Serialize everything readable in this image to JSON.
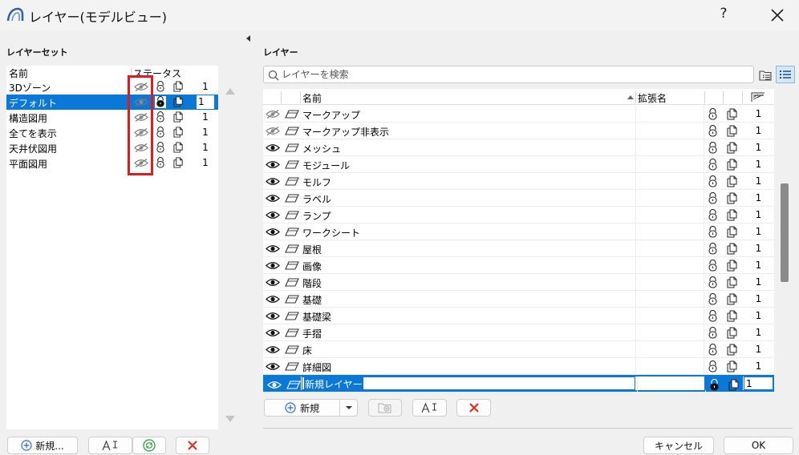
{
  "window": {
    "title": "レイヤー(モデルビュー)",
    "help_label": "?"
  },
  "left_panel": {
    "title": "レイヤーセット",
    "columns": {
      "name": "名前",
      "status": "ステータス"
    },
    "rows": [
      {
        "name": "3Dゾーン",
        "pen": "1",
        "selected": false
      },
      {
        "name": "デフォルト",
        "pen": "1",
        "selected": true
      },
      {
        "name": "構造図用",
        "pen": "1",
        "selected": false
      },
      {
        "name": "全てを表示",
        "pen": "1",
        "selected": false
      },
      {
        "name": "天井伏図用",
        "pen": "1",
        "selected": false
      },
      {
        "name": "平面図用",
        "pen": "1",
        "selected": false
      }
    ],
    "buttons": {
      "new_label": "新規..."
    }
  },
  "right_panel": {
    "title": "レイヤー",
    "search": {
      "placeholder": "レイヤーを検索",
      "value": ""
    },
    "columns": {
      "name": "名前",
      "extension": "拡張名"
    },
    "rows": [
      {
        "eye": "hidden",
        "name": "マークアップ",
        "pen": "1"
      },
      {
        "eye": "hidden",
        "name": "マークアップ非表示",
        "pen": "1"
      },
      {
        "eye": "visible",
        "name": "メッシュ",
        "pen": "1"
      },
      {
        "eye": "visible",
        "name": "モジュール",
        "pen": "1"
      },
      {
        "eye": "visible",
        "name": "モルフ",
        "pen": "1"
      },
      {
        "eye": "visible",
        "name": "ラベル",
        "pen": "1"
      },
      {
        "eye": "visible",
        "name": "ランプ",
        "pen": "1"
      },
      {
        "eye": "visible",
        "name": "ワークシート",
        "pen": "1"
      },
      {
        "eye": "visible",
        "name": "屋根",
        "pen": "1"
      },
      {
        "eye": "visible",
        "name": "画像",
        "pen": "1"
      },
      {
        "eye": "visible",
        "name": "階段",
        "pen": "1"
      },
      {
        "eye": "visible",
        "name": "基礎",
        "pen": "1"
      },
      {
        "eye": "visible",
        "name": "基礎梁",
        "pen": "1"
      },
      {
        "eye": "visible",
        "name": "手摺",
        "pen": "1"
      },
      {
        "eye": "visible",
        "name": "床",
        "pen": "1"
      },
      {
        "eye": "visible",
        "name": "詳細図",
        "pen": "1"
      }
    ],
    "new_row": {
      "name": "新規レイヤー",
      "pen": "1"
    },
    "buttons": {
      "new_label": "新規"
    }
  },
  "footer": {
    "cancel_label": "キャンセル",
    "ok_label": "OK"
  },
  "colors": {
    "accent": "#0a78d7",
    "highlight_box": "#e01b1b",
    "delete": "#e0301e",
    "refresh": "#2ea043"
  }
}
